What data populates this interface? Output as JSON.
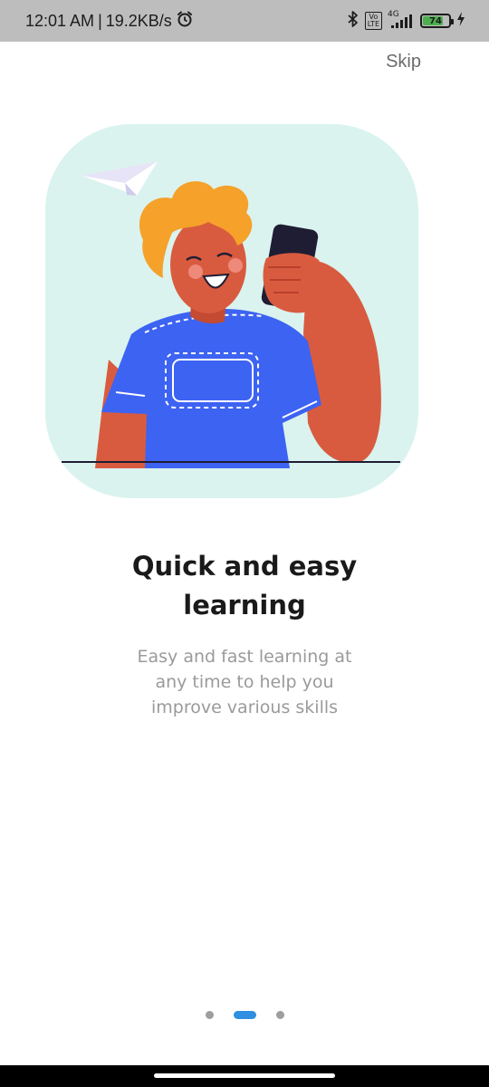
{
  "status_bar": {
    "time": "12:01 AM",
    "separator": "|",
    "speed": "19.2KB/s",
    "volte_label": "Vo\nLTE",
    "network_label": "4G",
    "battery_level": "74",
    "icons": [
      "alarm-icon",
      "bluetooth-icon",
      "volte-icon",
      "signal-icon",
      "battery-icon",
      "charging-icon"
    ]
  },
  "onboarding": {
    "skip_label": "Skip",
    "title": "Quick and easy\nlearning",
    "description": "Easy and fast learning at\nany time to help you\nimprove various skills",
    "illustration": "person-with-phone-illustration",
    "page_count": 3,
    "active_page": 2
  },
  "colors": {
    "status_bar_bg": "#bdbdbd",
    "hero_bg": "#daf3ef",
    "title": "#1a1a1a",
    "description": "#9a9a9a",
    "skip": "#6b6b6b",
    "indicator_active": "#2f8fe0",
    "indicator_inactive": "#9e9e9e",
    "battery_fill": "#4caf50",
    "shirt": "#3d63f2",
    "skin": "#d95b3f",
    "hair": "#f5a12a"
  }
}
